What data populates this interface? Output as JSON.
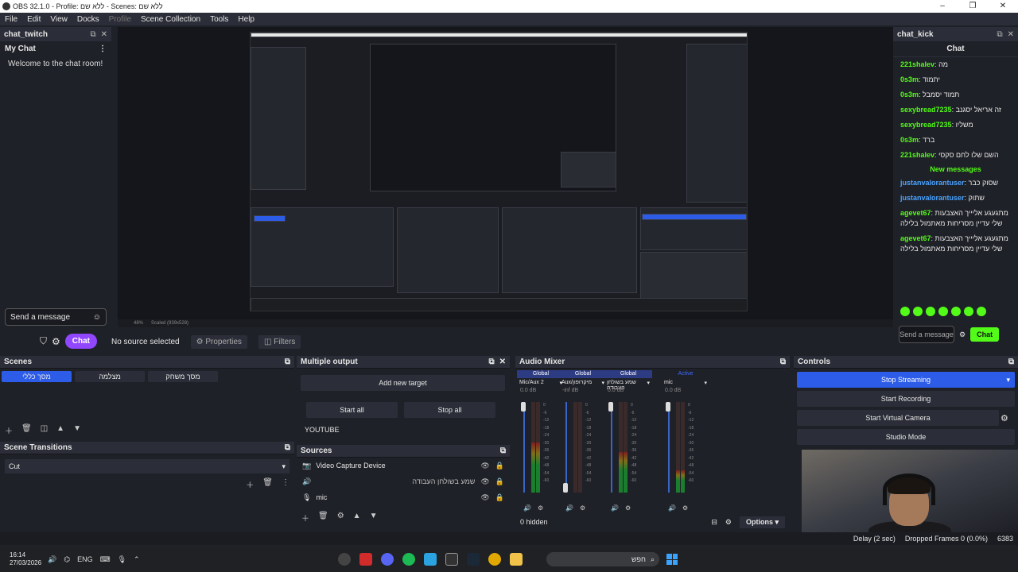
{
  "window": {
    "title": "OBS 32.1.0 - Profile: ללא שם - Scenes: ללא שם",
    "buttons": [
      "–",
      "❐",
      "✕"
    ]
  },
  "menu": {
    "items": [
      "File",
      "Edit",
      "View",
      "Docks"
    ],
    "profile": "Profile",
    "items2": [
      "Scene Collection",
      "Tools",
      "Help"
    ]
  },
  "chat_twitch": {
    "dock_title": "chat_twitch",
    "header": "My Chat",
    "welcome": "Welcome to the chat room!",
    "send_placeholder": "Send a message",
    "chat_button": "Chat"
  },
  "preview": {
    "zoom": "48%",
    "scaled": "Scaled (939x528)",
    "no_source": "No source selected",
    "properties": "Properties",
    "filters": "Filters"
  },
  "chat_kick": {
    "dock_title": "chat_kick",
    "title": "Chat",
    "messages": [
      {
        "user": "221shalev",
        "text": "מה",
        "color": "green"
      },
      {
        "user": "0s3m",
        "text": "יתמוד",
        "color": "green"
      },
      {
        "user": "0s3m",
        "text": "תמוד יסמבל",
        "color": "green"
      },
      {
        "user": "sexybread7235",
        "text": "זה אריאל יסגנב",
        "color": "green"
      },
      {
        "user": "sexybread7235",
        "text": "משליו",
        "color": "green"
      },
      {
        "user": "0s3m",
        "text": "ברד",
        "color": "green"
      },
      {
        "user": "221shalev",
        "text": "השם שלו לחם סקסי",
        "color": "green"
      }
    ],
    "new_messages": "New messages",
    "messages2": [
      {
        "user": "justanvalorantuser",
        "text": "שסוק כבר",
        "color": "blue"
      },
      {
        "user": "justanvalorantuser",
        "text": "שתוק",
        "color": "blue"
      },
      {
        "user": "agevet67",
        "text": "מתגעגע אליייך האצבעות שלי עדיין מסריחות מאתמול בלילה",
        "color": "green"
      },
      {
        "user": "agevet67",
        "text": "מתגעגע אליייך האצבעות שלי עדיין מסריחות מאתמול בלילה",
        "color": "green"
      }
    ],
    "send_placeholder": "Send a message",
    "chat_button": "Chat"
  },
  "scenes": {
    "title": "Scenes",
    "items": [
      "מסך כללי",
      "מצלמה",
      "מסך משחק"
    ],
    "active_index": 0
  },
  "transitions": {
    "title": "Scene Transitions",
    "selected": "Cut"
  },
  "multiple_output": {
    "title": "Multiple output",
    "add_target": "Add new target",
    "start_all": "Start all",
    "stop_all": "Stop all",
    "target": "YOUTUBE"
  },
  "sources": {
    "title": "Sources",
    "items": [
      {
        "name": "Video Capture Device",
        "icon": "camera-icon"
      },
      {
        "name": "שמע בשולחן העבודה",
        "icon": "speaker-icon"
      },
      {
        "name": "mic",
        "icon": "mic-icon"
      }
    ]
  },
  "audio_mixer": {
    "title": "Audio Mixer",
    "channels": [
      {
        "tag": "Global",
        "name": "Mic/Aux 2",
        "db": "0.0 dB",
        "level": 0.55,
        "fader": 1.0
      },
      {
        "tag": "Global",
        "name": "Aux/מיקרופון",
        "db": "-inf dB",
        "level": 0.0,
        "fader": 0.0
      },
      {
        "tag": "Global",
        "name": "שמע בשולחן העבודה",
        "db": "0.0 dB",
        "level": 0.45,
        "fader": 1.0
      },
      {
        "tag": "Active",
        "name": "mic",
        "db": "0.0 dB",
        "level": 0.25,
        "fader": 1.0
      }
    ],
    "scale": [
      "0",
      "-6",
      "-12",
      "-18",
      "-24",
      "-30",
      "-36",
      "-42",
      "-48",
      "-54",
      "-60"
    ],
    "hidden": "0 hidden",
    "options": "Options"
  },
  "controls": {
    "title": "Controls",
    "stop_streaming": "Stop Streaming",
    "start_recording": "Start Recording",
    "start_virtual_camera": "Start Virtual Camera",
    "studio_mode": "Studio Mode"
  },
  "status": {
    "delay": "Delay (2 sec)",
    "dropped": "Dropped Frames 0 (0.0%)",
    "kbps": "6383"
  },
  "taskbar": {
    "time": "16:14",
    "date": "27/03/2026",
    "lang": "ENG",
    "search": "חפש"
  },
  "colors": {
    "accent_blue": "#2d5de8",
    "kick_green": "#53fc18",
    "twitch_purple": "#9147ff"
  }
}
